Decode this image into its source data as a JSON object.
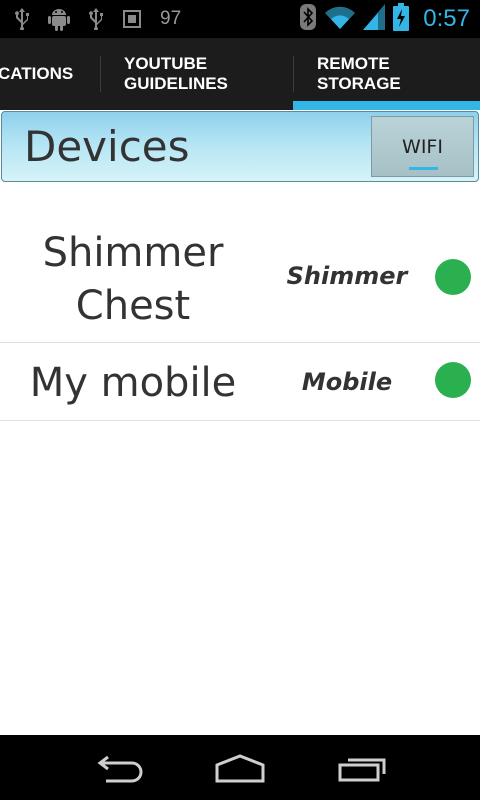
{
  "status_bar": {
    "left_icons": [
      "usb-icon",
      "android-debug-icon",
      "usb-icon",
      "screenshot-icon"
    ],
    "battery_level_text": "97",
    "right_icons": [
      "bluetooth-icon",
      "wifi-icon",
      "signal-icon",
      "battery-charging-icon"
    ],
    "clock": "0:57",
    "accent_color": "#33b5e5"
  },
  "tabs": [
    {
      "label": "CATIONS"
    },
    {
      "label": "YOUTUBE\nGUIDELINES"
    },
    {
      "label": "REMOTE\nSTORAGE"
    }
  ],
  "selected_tab": "REMOTE\nSTORAGE",
  "header": {
    "title": "Devices",
    "wifi_button_label": "WIFI"
  },
  "devices": [
    {
      "name": "Shimmer\nChest",
      "type": "Shimmer",
      "status_color": "#2bb04f"
    },
    {
      "name": "My mobile",
      "type": "Mobile",
      "status_color": "#2bb04f"
    }
  ],
  "nav_bar": {
    "buttons": [
      "back-icon",
      "home-icon",
      "recent-apps-icon"
    ]
  }
}
